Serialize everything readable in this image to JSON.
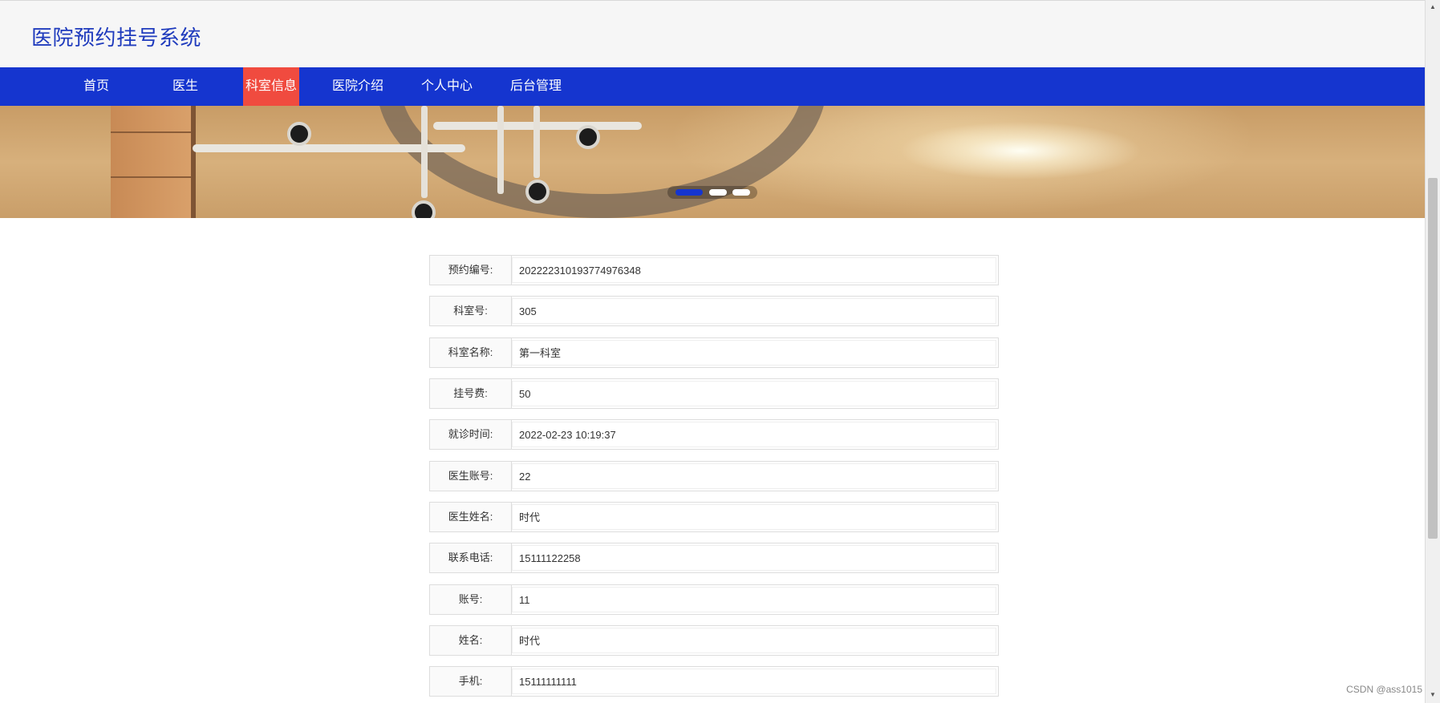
{
  "site": {
    "title": "医院预约挂号系统"
  },
  "nav": {
    "items": [
      {
        "label": "首页",
        "active": false
      },
      {
        "label": "医生",
        "active": false
      },
      {
        "label": "科室信息",
        "active": true
      },
      {
        "label": "医院介绍",
        "active": false
      },
      {
        "label": "个人中心",
        "active": false
      },
      {
        "label": "后台管理",
        "active": false
      }
    ]
  },
  "banner": {
    "slide_count": 3,
    "active_slide": 1
  },
  "details": {
    "rows": [
      {
        "label": "预约编号:",
        "value": "2022223101937749763​48"
      },
      {
        "label": "科室号:",
        "value": "305"
      },
      {
        "label": "科室名称:",
        "value": "第一科室"
      },
      {
        "label": "挂号费:",
        "value": "50"
      },
      {
        "label": "就诊时间:",
        "value": "2022-02-23 10:19:37"
      },
      {
        "label": "医生账号:",
        "value": "22"
      },
      {
        "label": "医生姓名:",
        "value": "时代"
      },
      {
        "label": "联系电话:",
        "value": "15111122258"
      },
      {
        "label": "账号:",
        "value": "11"
      },
      {
        "label": "姓名:",
        "value": "时代"
      },
      {
        "label": "手机:",
        "value": "15111111111"
      }
    ]
  },
  "watermark": "CSDN @ass1015",
  "colors": {
    "nav_bg": "#1535cf",
    "nav_active": "#f04b3f",
    "title": "#1f3bbd",
    "header_bg": "#f6f6f6"
  }
}
